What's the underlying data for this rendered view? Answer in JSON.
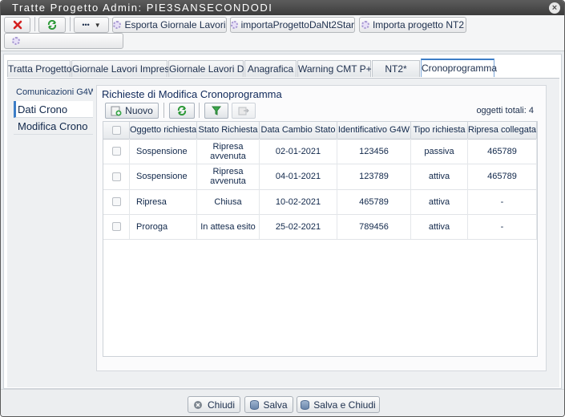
{
  "window": {
    "title": "Tratte Progetto Admin: PIE3SANSECONDODI"
  },
  "toolbar": {
    "more_label": "•••",
    "export_label": "Esporta Giornale Lavori",
    "import_label": "importaProgettoDaNt2Star",
    "import_nt2_label": "Importa progetto NT2"
  },
  "tabs": [
    {
      "label": "Tratta Progetto"
    },
    {
      "label": "Giornale Lavori Impresa"
    },
    {
      "label": "Giornale Lavori DL"
    },
    {
      "label": "Anagrafica"
    },
    {
      "label": "Warning CMT P+"
    },
    {
      "label": "NT2*"
    },
    {
      "label": "Cronoprogramma"
    }
  ],
  "leftnav": {
    "header": "Comunicazioni G4W",
    "items": [
      {
        "label": "Dati Crono"
      },
      {
        "label": "Modifica Crono"
      }
    ]
  },
  "main": {
    "title": "Richieste di Modifica Cronoprogramma",
    "new_label": "Nuovo",
    "count_label": "oggetti totali: 4"
  },
  "grid": {
    "columns": [
      "Oggetto richiesta",
      "Stato Richiesta",
      "Data Cambio Stato",
      "Identificativo G4W",
      "Tipo richiesta",
      "Ripresa collegata"
    ],
    "rows": [
      [
        "Sospensione",
        "Ripresa avvenuta",
        "02-01-2021",
        "123456",
        "passiva",
        "465789"
      ],
      [
        "Sospensione",
        "Ripresa avvenuta",
        "04-01-2021",
        "123789",
        "attiva",
        "465789"
      ],
      [
        "Ripresa",
        "Chiusa",
        "10-02-2021",
        "465789",
        "attiva",
        "-"
      ],
      [
        "Proroga",
        "In attesa esito",
        "25-02-2021",
        "789456",
        "attiva",
        "-"
      ]
    ]
  },
  "footer": {
    "close_label": "Chiudi",
    "save_label": "Salva",
    "save_close_label": "Salva e Chiudi"
  },
  "colors": {
    "accent": "#3b7dc7",
    "cancel_red": "#d42020",
    "refresh_green": "#2f9a3a"
  }
}
